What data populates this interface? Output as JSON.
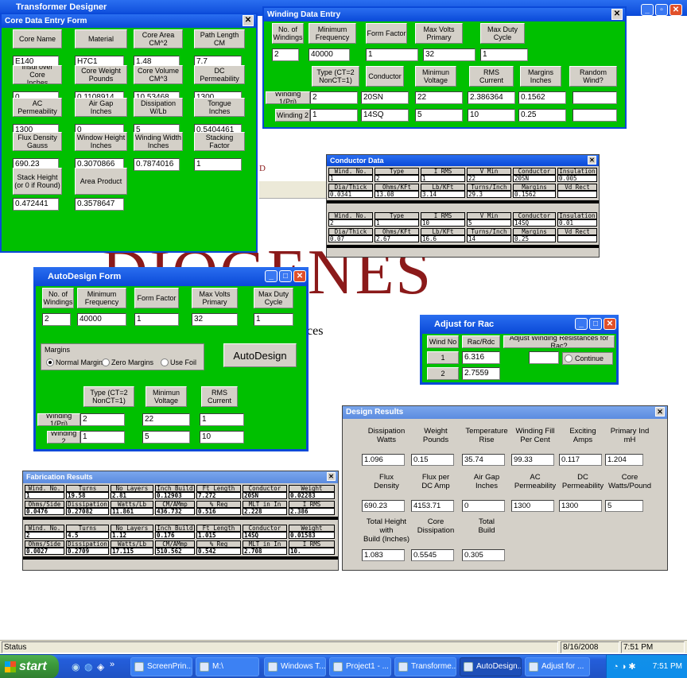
{
  "app": {
    "title": "Transformer Designer",
    "bg_word": "DIOGENES",
    "bg_ces": "ces",
    "bg_d": "D"
  },
  "core": {
    "title": "Core Data Entry Form",
    "fields": [
      {
        "label": "Core Name",
        "value": "E140"
      },
      {
        "label": "Material",
        "value": "H7C1"
      },
      {
        "label": "Core Area\nCM^2",
        "value": "1.48"
      },
      {
        "label": "Path Length\nCM",
        "value": "7.7"
      },
      {
        "label": "Insul over Core\nInches",
        "value": "0"
      },
      {
        "label": "Core Weight\nPounds",
        "value": "0.1108914"
      },
      {
        "label": "Core Volume\nCM^3",
        "value": "10.53468"
      },
      {
        "label": "DC Permeability",
        "value": "1300"
      },
      {
        "label": "AC Permeability",
        "value": "1300"
      },
      {
        "label": "Air Gap\nInches",
        "value": "0"
      },
      {
        "label": "Dissipation\nW/Lb",
        "value": "5"
      },
      {
        "label": "Tongue\nInches",
        "value": "0.5404461"
      },
      {
        "label": "Flux Density\nGauss",
        "value": "690.23"
      },
      {
        "label": "Window Height\nInches",
        "value": "0.3070866"
      },
      {
        "label": "Winding Width\nInches",
        "value": "0.7874016"
      },
      {
        "label": "Stacking Factor",
        "value": "1"
      },
      {
        "label": "Stack Height\n(or 0 if Round)",
        "value": "0.472441"
      },
      {
        "label": "Area Product",
        "value": "0.3578647"
      }
    ]
  },
  "winding": {
    "title": "Winding Data Entry",
    "top_labels": [
      "No. of\nWindings",
      "Minimum\nFrequency",
      "Form Factor",
      "Max Volts\nPrimary",
      "Max Duty\nCycle"
    ],
    "top_values": [
      "2",
      "40000",
      "1",
      "32",
      "1"
    ],
    "col_labels": [
      "Type (CT=2\nNonCT=1)",
      "Conductor",
      "Minimun\nVoltage",
      "RMS\nCurrent",
      "Margins\nInches",
      "Random\nWind?"
    ],
    "rows": [
      {
        "label": "Winding 1(Pri)",
        "values": [
          "2",
          "20SN",
          "22",
          "2.386364",
          "0.1562",
          ""
        ]
      },
      {
        "label": "Winding 2",
        "values": [
          "1",
          "14SQ",
          "5",
          "10",
          "0.25",
          ""
        ]
      }
    ]
  },
  "conductor": {
    "title": "Conductor Data",
    "h1": [
      "Wind. No.",
      "Type",
      "I RMS",
      "V Min",
      "Conductor",
      "Insulation"
    ],
    "h2": [
      "Dia/Thick",
      "Ohms/KFt",
      "Lb/KFt",
      "Turns/Inch",
      "Margins",
      "Vd Rect"
    ],
    "blocks": [
      {
        "r1": [
          "1",
          "2",
          "1",
          "22",
          "20SN",
          "0.005"
        ],
        "r2": [
          "0.0341",
          "13.08",
          "3.14",
          "29.3",
          "0.1562",
          ""
        ]
      },
      {
        "r1": [
          "2",
          "1",
          "10",
          "5",
          "14SQ",
          "0.01"
        ],
        "r2": [
          "0.07",
          "2.67",
          "16.6",
          "14",
          "0.25",
          ""
        ]
      }
    ]
  },
  "autodesign": {
    "title": "AutoDesign Form",
    "top_labels": [
      "No. of\nWindings",
      "Minimum\nFrequency",
      "Form Factor",
      "Max Volts\nPrimary",
      "Max Duty\nCycle"
    ],
    "top_values": [
      "2",
      "40000",
      "1",
      "32",
      "1"
    ],
    "margins_label": "Margins",
    "radios": [
      "Normal Margins",
      "Zero Margins",
      "Use Foil"
    ],
    "button": "AutoDesign",
    "col_labels": [
      "Type (CT=2\nNonCT=1)",
      "Minimun\nVoltage",
      "RMS\nCurrent"
    ],
    "rows": [
      {
        "label": "Winding 1(Pri)",
        "values": [
          "2",
          "22",
          "1"
        ]
      },
      {
        "label": "Winding 2",
        "values": [
          "1",
          "5",
          "10"
        ]
      }
    ]
  },
  "adjust": {
    "title": "Adjust for  Rac",
    "h_wind": "Wind No",
    "h_rac": "Rac/Rdc",
    "h_adjust": "Adjust Winding Resistances for Rac?",
    "continue": "Continue",
    "rows": [
      {
        "n": "1",
        "v": "6.316"
      },
      {
        "n": "2",
        "v": "2.7559"
      }
    ]
  },
  "design": {
    "title": "Design Results",
    "labels": [
      "Dissipation\nWatts",
      "Weight\nPounds",
      "Temperature\nRise",
      "Winding Fill\nPer Cent",
      "Exciting\nAmps",
      "Primary Ind\nmH",
      "Flux\nDensity",
      "Flux per\nDC Amp",
      "Air Gap\nInches",
      "AC\nPermeability",
      "DC\nPermeability",
      "Core\nWatts/Pound",
      "Total Height with\nBuild (Inches)",
      "Core\nDissipation",
      "Total\nBuild"
    ],
    "values": [
      "1.096",
      "0.15",
      "35.74",
      "99.33",
      "0.117",
      "1.204",
      "690.23",
      "4153.71",
      "0",
      "1300",
      "1300",
      "5",
      "1.083",
      "0.5545",
      "0.305"
    ]
  },
  "fab": {
    "title": "Fabrication Results",
    "h1": [
      "Wind. No.",
      "Turns",
      "No Layers",
      "Inch Build",
      "Ft Length",
      "Conductor",
      "Weight"
    ],
    "h2": [
      "Ohms/Side",
      "Dissipation",
      "Watts/Lb",
      "CM/AMmp",
      "% Reg",
      "MLT in In",
      "I RMS"
    ],
    "blocks": [
      {
        "r1": [
          "1",
          "19.58",
          "2.81",
          "0.12903",
          "7.272",
          "20SN",
          "0.02283"
        ],
        "r2": [
          "0.0476",
          "0.27082",
          "11.861",
          "436.732",
          "0.516",
          "2.228",
          "2.386"
        ]
      },
      {
        "r1": [
          "2",
          "4.5",
          "1.12",
          "0.176",
          "1.015",
          "14SQ",
          "0.01583"
        ],
        "r2": [
          "0.0027",
          "0.2709",
          "17.115",
          "510.562",
          "0.542",
          "2.708",
          "10."
        ]
      }
    ]
  },
  "status": {
    "text": "Status",
    "date": "8/16/2008",
    "time": "7:51 PM"
  },
  "taskbar": {
    "start": "start",
    "items": [
      "ScreenPrin...",
      "M:\\",
      "Windows T...",
      "Project1 - ...",
      "Transforme...",
      "AutoDesign...",
      "Adjust for ..."
    ],
    "clock": "7:51 PM"
  },
  "colors": {
    "form_green": "#00c000",
    "title_blue": "#0a49d8",
    "taskbar_blue": "#245edb",
    "start_green": "#3c9a3c"
  }
}
